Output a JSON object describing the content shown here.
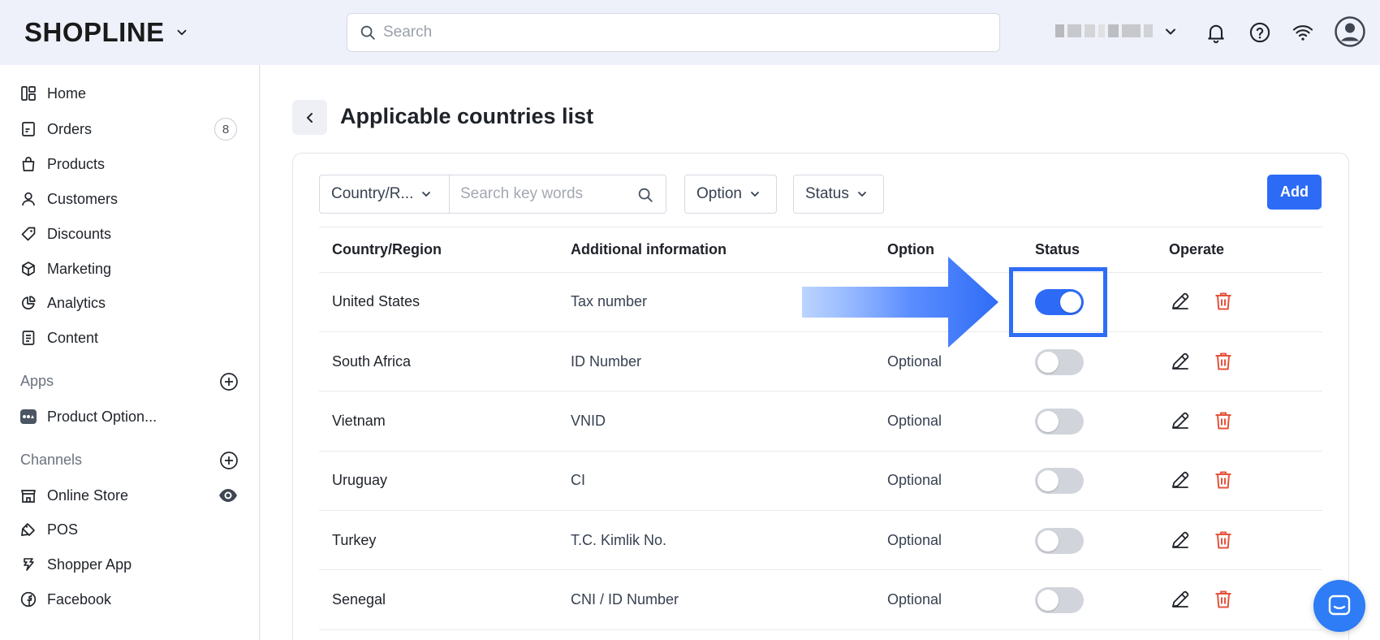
{
  "header": {
    "logo_text": "SHOPLINE",
    "search_placeholder": "Search"
  },
  "sidebar": {
    "items": [
      {
        "label": "Home"
      },
      {
        "label": "Orders",
        "badge": "8"
      },
      {
        "label": "Products"
      },
      {
        "label": "Customers"
      },
      {
        "label": "Discounts"
      },
      {
        "label": "Marketing"
      },
      {
        "label": "Analytics"
      },
      {
        "label": "Content"
      }
    ],
    "apps_label": "Apps",
    "apps": [
      {
        "label": "Product Option..."
      }
    ],
    "channels_label": "Channels",
    "channels": [
      {
        "label": "Online Store"
      },
      {
        "label": "POS"
      },
      {
        "label": "Shopper App"
      },
      {
        "label": "Facebook"
      }
    ]
  },
  "page": {
    "title": "Applicable countries list",
    "filters": {
      "country_label": "Country/R...",
      "keyword_placeholder": "Search key words",
      "option_label": "Option",
      "status_label": "Status"
    },
    "add_label": "Add",
    "columns": [
      "Country/Region",
      "Additional information",
      "Option",
      "Status",
      "Operate"
    ],
    "rows": [
      {
        "country": "United States",
        "info": "Tax number",
        "option": "",
        "status": true
      },
      {
        "country": "South Africa",
        "info": "ID Number",
        "option": "Optional",
        "status": false
      },
      {
        "country": "Vietnam",
        "info": "VNID",
        "option": "Optional",
        "status": false
      },
      {
        "country": "Uruguay",
        "info": "CI",
        "option": "Optional",
        "status": false
      },
      {
        "country": "Turkey",
        "info": "T.C. Kimlik No.",
        "option": "Optional",
        "status": false
      },
      {
        "country": "Senegal",
        "info": "CNI / ID Number",
        "option": "Optional",
        "status": false
      }
    ]
  },
  "colors": {
    "accent": "#2d6bf6",
    "delete": "#e5533d",
    "toggle_off": "#d1d5db"
  }
}
